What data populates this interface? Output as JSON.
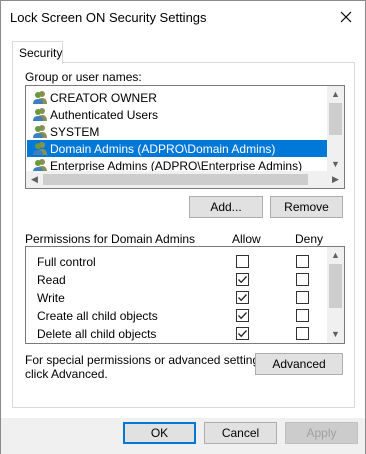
{
  "window": {
    "title": "Lock Screen ON Security Settings",
    "close_icon": "close-icon"
  },
  "tabs": [
    {
      "label": "Security",
      "selected": true
    }
  ],
  "groups": {
    "label": "Group or user names:",
    "items": [
      {
        "name": "CREATOR OWNER",
        "icon": "users-icon",
        "selected": false
      },
      {
        "name": "Authenticated Users",
        "icon": "users-icon",
        "selected": false
      },
      {
        "name": "SYSTEM",
        "icon": "users-icon",
        "selected": false
      },
      {
        "name": "Domain Admins (ADPRO\\Domain Admins)",
        "icon": "users-icon",
        "selected": true
      },
      {
        "name": "Enterprise Admins (ADPRO\\Enterprise Admins)",
        "icon": "users-icon",
        "selected": false
      }
    ],
    "add_label": "Add...",
    "remove_label": "Remove"
  },
  "permissions": {
    "label": "Permissions for Domain Admins",
    "allow_header": "Allow",
    "deny_header": "Deny",
    "rows": [
      {
        "name": "Full control",
        "allow": false,
        "deny": false
      },
      {
        "name": "Read",
        "allow": true,
        "deny": false
      },
      {
        "name": "Write",
        "allow": true,
        "deny": false
      },
      {
        "name": "Create all child objects",
        "allow": true,
        "deny": false
      },
      {
        "name": "Delete all child objects",
        "allow": true,
        "deny": false
      }
    ]
  },
  "advanced": {
    "note": "For special permissions or advanced settings, click Advanced.",
    "line1": "For special permissions or advanced settings,",
    "line2": "click Advanced.",
    "button_label": "Advanced"
  },
  "footer": {
    "ok_label": "OK",
    "cancel_label": "Cancel",
    "apply_label": "Apply",
    "apply_enabled": false
  },
  "colors": {
    "selection": "#0078d7",
    "button_face": "#e1e1e1",
    "disabled_text": "#a0a0a0"
  }
}
